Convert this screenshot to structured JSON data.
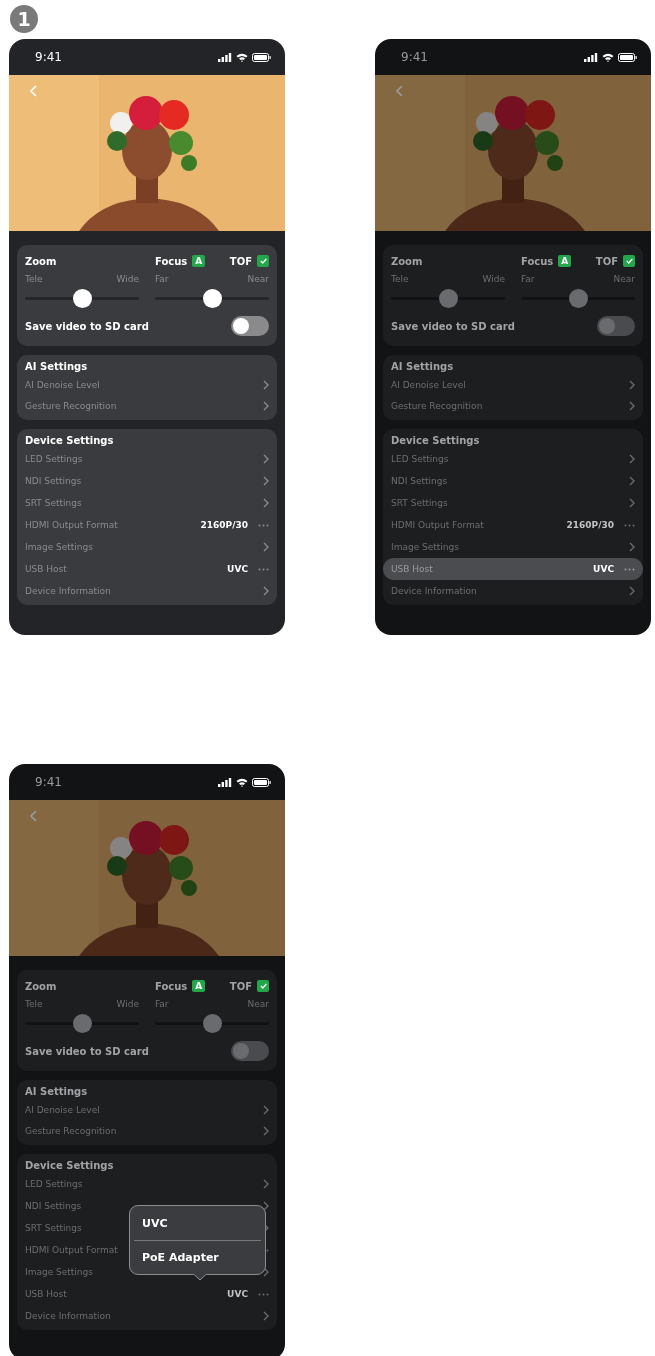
{
  "step_badge": "1",
  "screens": [
    {
      "dimmed": false,
      "status_time": "9:41",
      "zoom": {
        "title": "Zoom",
        "min_label": "Tele",
        "max_label": "Wide",
        "level": 0.5
      },
      "focus": {
        "title": "Focus",
        "auto_badge": "A",
        "min_label": "Far",
        "max_label": "Near",
        "level": 0.5
      },
      "tof": {
        "label": "TOF",
        "checked": true
      },
      "save_video": {
        "label": "Save video to SD card",
        "on": false
      },
      "ai_settings": {
        "title": "AI Settings",
        "items": [
          {
            "label": "AI Denoise Level",
            "kind": "link",
            "highlighted": false
          },
          {
            "label": "Gesture Recognition",
            "kind": "link",
            "highlighted": false
          }
        ]
      },
      "device_settings": {
        "title": "Device Settings",
        "items": [
          {
            "label": "LED Settings",
            "kind": "link",
            "highlighted": false
          },
          {
            "label": "NDI Settings",
            "kind": "link",
            "highlighted": false
          },
          {
            "label": "SRT Settings",
            "kind": "link",
            "highlighted": false
          },
          {
            "label": "HDMI Output Format",
            "kind": "value",
            "value": "2160P/30",
            "highlighted": false
          },
          {
            "label": "Image Settings",
            "kind": "link",
            "highlighted": false
          },
          {
            "label": "USB Host",
            "kind": "value",
            "value": "UVC",
            "highlighted": false
          },
          {
            "label": "Device Information",
            "kind": "link",
            "highlighted": false
          }
        ]
      }
    },
    {
      "dimmed": true,
      "status_time": "9:41",
      "zoom": {
        "title": "Zoom",
        "min_label": "Tele",
        "max_label": "Wide",
        "level": 0.5
      },
      "focus": {
        "title": "Focus",
        "auto_badge": "A",
        "min_label": "Far",
        "max_label": "Near",
        "level": 0.5
      },
      "tof": {
        "label": "TOF",
        "checked": true
      },
      "save_video": {
        "label": "Save video to SD card",
        "on": false
      },
      "ai_settings": {
        "title": "AI Settings",
        "items": [
          {
            "label": "AI Denoise Level",
            "kind": "link",
            "highlighted": false
          },
          {
            "label": "Gesture Recognition",
            "kind": "link",
            "highlighted": false
          }
        ]
      },
      "device_settings": {
        "title": "Device Settings",
        "items": [
          {
            "label": "LED Settings",
            "kind": "link",
            "highlighted": false
          },
          {
            "label": "NDI Settings",
            "kind": "link",
            "highlighted": false
          },
          {
            "label": "SRT Settings",
            "kind": "link",
            "highlighted": false
          },
          {
            "label": "HDMI Output Format",
            "kind": "value",
            "value": "2160P/30",
            "highlighted": false
          },
          {
            "label": "Image Settings",
            "kind": "link",
            "highlighted": false
          },
          {
            "label": "USB Host",
            "kind": "value",
            "value": "UVC",
            "highlighted": true
          },
          {
            "label": "Device Information",
            "kind": "link",
            "highlighted": false
          }
        ]
      }
    },
    {
      "dimmed": true,
      "status_time": "9:41",
      "zoom": {
        "title": "Zoom",
        "min_label": "Tele",
        "max_label": "Wide",
        "level": 0.5
      },
      "focus": {
        "title": "Focus",
        "auto_badge": "A",
        "min_label": "Far",
        "max_label": "Near",
        "level": 0.5
      },
      "tof": {
        "label": "TOF",
        "checked": true
      },
      "save_video": {
        "label": "Save video to SD card",
        "on": false
      },
      "ai_settings": {
        "title": "AI Settings",
        "items": [
          {
            "label": "AI Denoise Level",
            "kind": "link",
            "highlighted": false
          },
          {
            "label": "Gesture Recognition",
            "kind": "link",
            "highlighted": false
          }
        ]
      },
      "device_settings": {
        "title": "Device Settings",
        "items": [
          {
            "label": "LED Settings",
            "kind": "link",
            "highlighted": false
          },
          {
            "label": "NDI Settings",
            "kind": "link",
            "highlighted": false
          },
          {
            "label": "SRT Settings",
            "kind": "link",
            "highlighted": false
          },
          {
            "label": "HDMI Output Format",
            "kind": "value",
            "highlighted": false
          },
          {
            "label": "Image Settings",
            "kind": "link",
            "highlighted": false
          },
          {
            "label": "USB Host",
            "kind": "value",
            "value": "UVC",
            "highlighted": false,
            "popover": {
              "options": [
                {
                  "label": "UVC"
                },
                {
                  "label": "PoE Adapter"
                }
              ]
            }
          },
          {
            "label": "Device Information",
            "kind": "link",
            "highlighted": false
          }
        ]
      }
    }
  ]
}
